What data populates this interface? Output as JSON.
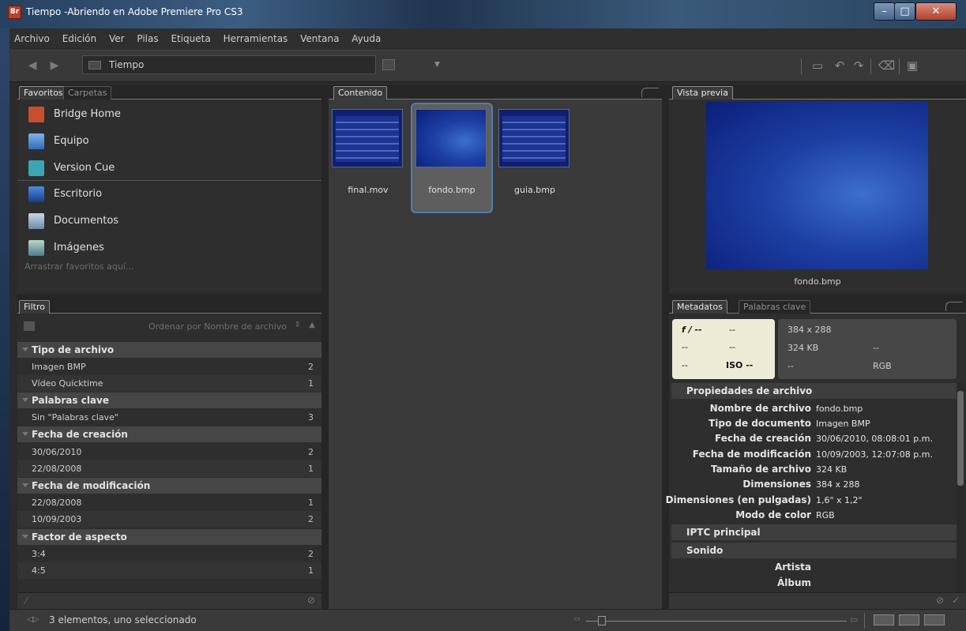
{
  "window": {
    "app_badge": "Br",
    "title": "Tiempo -Abriendo en Adobe Premiere Pro CS3"
  },
  "menubar": [
    "Archivo",
    "Edición",
    "Ver",
    "Pilas",
    "Etiqueta",
    "Herramientas",
    "Ventana",
    "Ayuda"
  ],
  "pathbar": {
    "path": "Tiempo"
  },
  "favorites": {
    "tabs": [
      "Favoritos",
      "Carpetas"
    ],
    "items": [
      {
        "label": "Bridge Home",
        "icon": "bridge-home-icon"
      },
      {
        "label": "Equipo",
        "icon": "computer-icon"
      },
      {
        "label": "Version Cue",
        "icon": "version-cue-icon"
      },
      {
        "label": "Escritorio",
        "icon": "desktop-icon"
      },
      {
        "label": "Documentos",
        "icon": "documents-icon"
      },
      {
        "label": "Imágenes",
        "icon": "pictures-icon"
      }
    ],
    "hint": "Arrastrar favoritos aquí..."
  },
  "filter": {
    "tab": "Filtro",
    "sort_label": "Ordenar por Nombre de archivo",
    "groups": [
      {
        "title": "Tipo de archivo",
        "rows": [
          {
            "label": "Imagen BMP",
            "count": "2"
          },
          {
            "label": "Vídeo Quicktime",
            "count": "1"
          }
        ]
      },
      {
        "title": "Palabras clave",
        "rows": [
          {
            "label": "Sin \"Palabras clave\"",
            "count": "3"
          }
        ]
      },
      {
        "title": "Fecha de creación",
        "rows": [
          {
            "label": "30/06/2010",
            "count": "2"
          },
          {
            "label": "22/08/2008",
            "count": "1"
          }
        ]
      },
      {
        "title": "Fecha de modificación",
        "rows": [
          {
            "label": "22/08/2008",
            "count": "1"
          },
          {
            "label": "10/09/2003",
            "count": "2"
          }
        ]
      },
      {
        "title": "Factor de aspecto",
        "rows": [
          {
            "label": "3:4",
            "count": "2"
          },
          {
            "label": "4:5",
            "count": "1"
          }
        ]
      }
    ]
  },
  "content": {
    "tab": "Contenido",
    "items": [
      {
        "name": "final.mov",
        "selected": false,
        "kind": "table"
      },
      {
        "name": "fondo.bmp",
        "selected": true,
        "kind": "map"
      },
      {
        "name": "guia.bmp",
        "selected": false,
        "kind": "table"
      }
    ]
  },
  "preview": {
    "tab": "Vista previa",
    "caption": "fondo.bmp"
  },
  "metadata": {
    "tabs": [
      "Metadatos",
      "Palabras clave"
    ],
    "camera": {
      "aperture": "f / --",
      "a2": "--",
      "b1": "--",
      "b2": "--",
      "c1": "--",
      "iso": "ISO --"
    },
    "summary": {
      "dims": "384 x 288",
      "size": "324 KB",
      "s2": "--",
      "s3": "--",
      "mode": "RGB"
    },
    "sections": {
      "file_props": "Propiedades de archivo",
      "iptc": "IPTC principal",
      "sound": "Sonido"
    },
    "props": [
      {
        "label": "Nombre de archivo",
        "value": "fondo.bmp"
      },
      {
        "label": "Tipo de documento",
        "value": "Imagen BMP"
      },
      {
        "label": "Fecha de creación",
        "value": "30/06/2010, 08:08:01 p.m."
      },
      {
        "label": "Fecha de modificación",
        "value": "10/09/2003, 12:07:08 p.m."
      },
      {
        "label": "Tamaño de archivo",
        "value": "324 KB"
      },
      {
        "label": "Dimensiones",
        "value": "384 x 288"
      },
      {
        "label": "Dimensiones (en pulgadas)",
        "value": "1,6\" x 1,2\""
      },
      {
        "label": "Modo de color",
        "value": "RGB"
      }
    ],
    "sound_props": [
      {
        "label": "Artista",
        "value": ""
      },
      {
        "label": "Álbum",
        "value": ""
      }
    ]
  },
  "status": {
    "text": "3 elementos, uno seleccionado"
  },
  "colors": {
    "accent": "#4f7cb5",
    "panel": "#2e2e2e",
    "titlebar": "#2d4a6b"
  }
}
